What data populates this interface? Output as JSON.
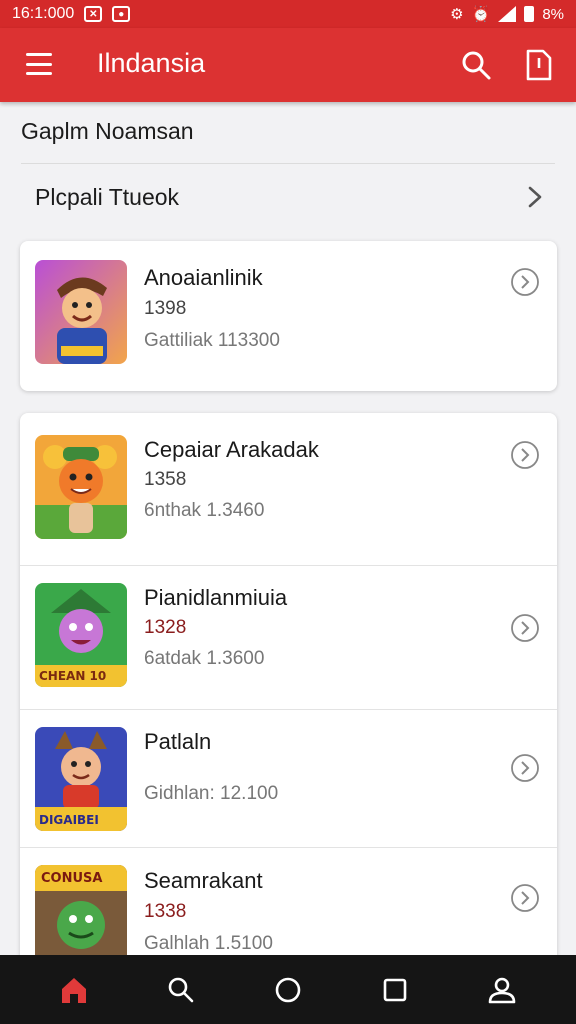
{
  "status_bar": {
    "time": "16:1:000",
    "battery": "8%"
  },
  "app_bar": {
    "title": "Ilndansia"
  },
  "section": {
    "title": "Gaplm Noamsan"
  },
  "nav_row": {
    "label": "Plcpali Ttueok"
  },
  "featured": {
    "title": "Anoaianlinik",
    "rating": "1398",
    "subtitle": "Gattiliak 113300",
    "thumb_label": ""
  },
  "games": [
    {
      "title": "Cepaiar Arakadak",
      "rating": "1358",
      "subtitle": "6nthak 1.3460",
      "thumb_label": ""
    },
    {
      "title": "Pianidlanmiuia",
      "rating": "1328",
      "subtitle": "6atdak 1.3600",
      "thumb_label": "CHEAN 10"
    },
    {
      "title": "Patlaln",
      "rating": "",
      "subtitle": "Gidhlan: 12.100",
      "thumb_label": "DIGAIBEI"
    },
    {
      "title": "Seamrakant",
      "rating": "1338",
      "subtitle": "Galhlah 1.5100",
      "thumb_label": "CONUSA"
    }
  ],
  "colors": {
    "brand": "#dc3232",
    "bottom_nav": "#151515",
    "active_nav": "#e03a3a"
  },
  "bottom_nav": [
    "home-icon",
    "search-icon",
    "circle-icon",
    "square-icon",
    "profile-icon"
  ]
}
